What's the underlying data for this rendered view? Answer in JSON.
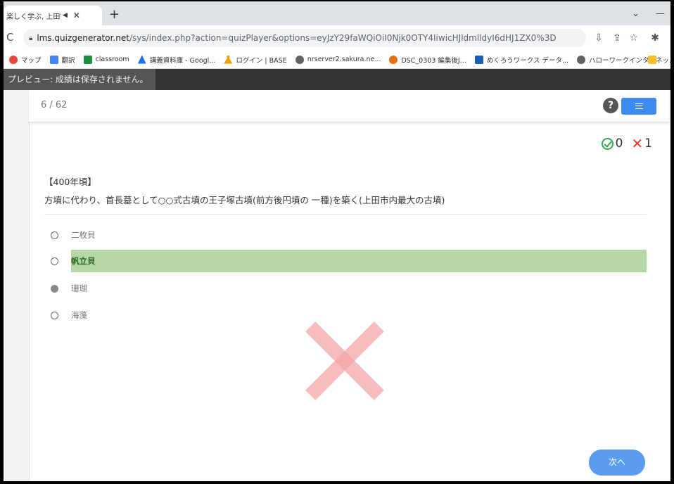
{
  "browser": {
    "tab_title": "楽しく学ぶ, 上田市歴史",
    "new_tab": "+",
    "url_host": "lms.quizgenerator.net",
    "url_path": "/sys/index.php?action=quizPlayer&options=eyJzY29faWQiOiI0Njk0OTY4IiwicHJldmlldyI6dHJ1ZX0%3D",
    "bookmarks": [
      {
        "label": "マップ",
        "color": "#e8453c",
        "icon": "map-pin-icon"
      },
      {
        "label": "翻訳",
        "color": "#4285f4",
        "icon": "translate-icon"
      },
      {
        "label": "classroom",
        "color": "#1e8e3e",
        "icon": "classroom-icon"
      },
      {
        "label": "講義資料庫 - Googl...",
        "color": "#1a73e8",
        "icon": "drive-icon"
      },
      {
        "label": "ログイン | BASE",
        "color": "#f0a000",
        "icon": "flask-icon"
      },
      {
        "label": "nrserver2.sakura.ne...",
        "color": "#5f6368",
        "icon": "globe-icon"
      },
      {
        "label": "DSC_0303 編集後J...",
        "color": "#e8710a",
        "icon": "photo-icon"
      },
      {
        "label": "めくろうワークス データ...",
        "color": "#1a5fb4",
        "icon": "bird-icon"
      },
      {
        "label": "ハローワークインターネッ...",
        "color": "#5f6368",
        "icon": "globe-icon"
      }
    ]
  },
  "preview_notice": "プレビュー: 成績は保存されません。",
  "quiz": {
    "progress": "6 / 62",
    "help": "?",
    "correct_count": "0",
    "wrong_count": "1",
    "question_label": "【400年頃】",
    "question_text": "方墳に代わり、首長墓として○○式古墳の王子塚古墳(前方後円墳の 一種)を築く(上田市内最大の古墳)",
    "options": [
      {
        "label": "二枚貝",
        "state": "unselected"
      },
      {
        "label": "帆立貝",
        "state": "correct"
      },
      {
        "label": "珊瑚",
        "state": "selected"
      },
      {
        "label": "海藻",
        "state": "unselected"
      }
    ],
    "next_label": "次へ"
  },
  "colors": {
    "correct_highlight": "#b5d6a7",
    "accent_blue": "#3d8bef",
    "wrong_mark": "#f3a5a8",
    "correct_icon": "#34a853",
    "wrong_icon": "#e53935"
  }
}
